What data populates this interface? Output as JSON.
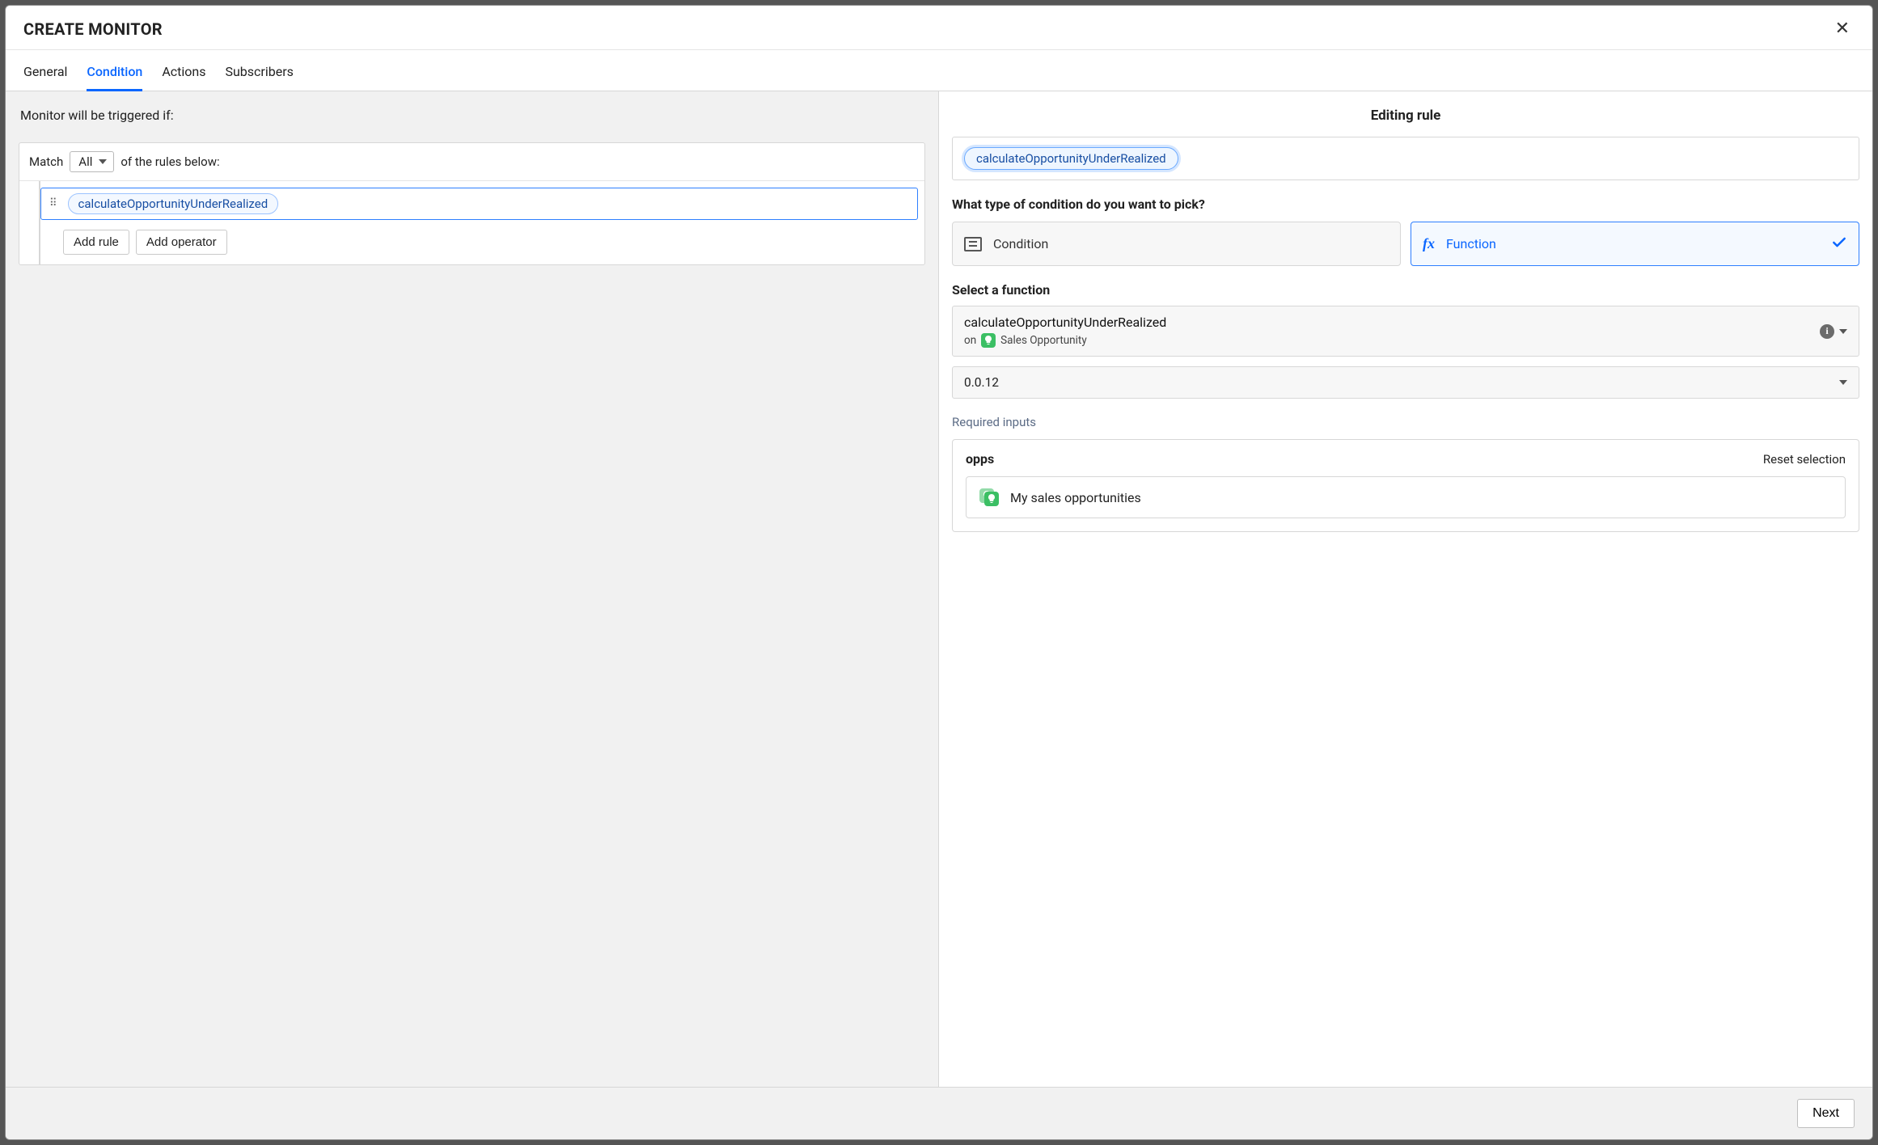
{
  "header": {
    "title": "CREATE MONITOR"
  },
  "tabs": {
    "general": "General",
    "condition": "Condition",
    "actions": "Actions",
    "subscribers": "Subscribers"
  },
  "left": {
    "trigger_note": "Monitor will be triggered if:",
    "match_label": "Match",
    "match_value": "All",
    "match_suffix": "of the rules below:",
    "rule_chip": "calculateOpportunityUnderRealized",
    "add_rule": "Add rule",
    "add_operator": "Add operator"
  },
  "right": {
    "editing_title": "Editing rule",
    "editing_chip": "calculateOpportunityUnderRealized",
    "question": "What type of condition do you want to pick?",
    "type_condition": "Condition",
    "type_function": "Function",
    "select_function_label": "Select a function",
    "function_name": "calculateOpportunityUnderRealized",
    "function_on_prefix": "on",
    "function_on_target": "Sales Opportunity",
    "version": "0.0.12",
    "required_inputs": "Required inputs",
    "input_name": "opps",
    "reset_selection": "Reset selection",
    "input_value": "My sales opportunities"
  },
  "footer": {
    "next": "Next"
  }
}
